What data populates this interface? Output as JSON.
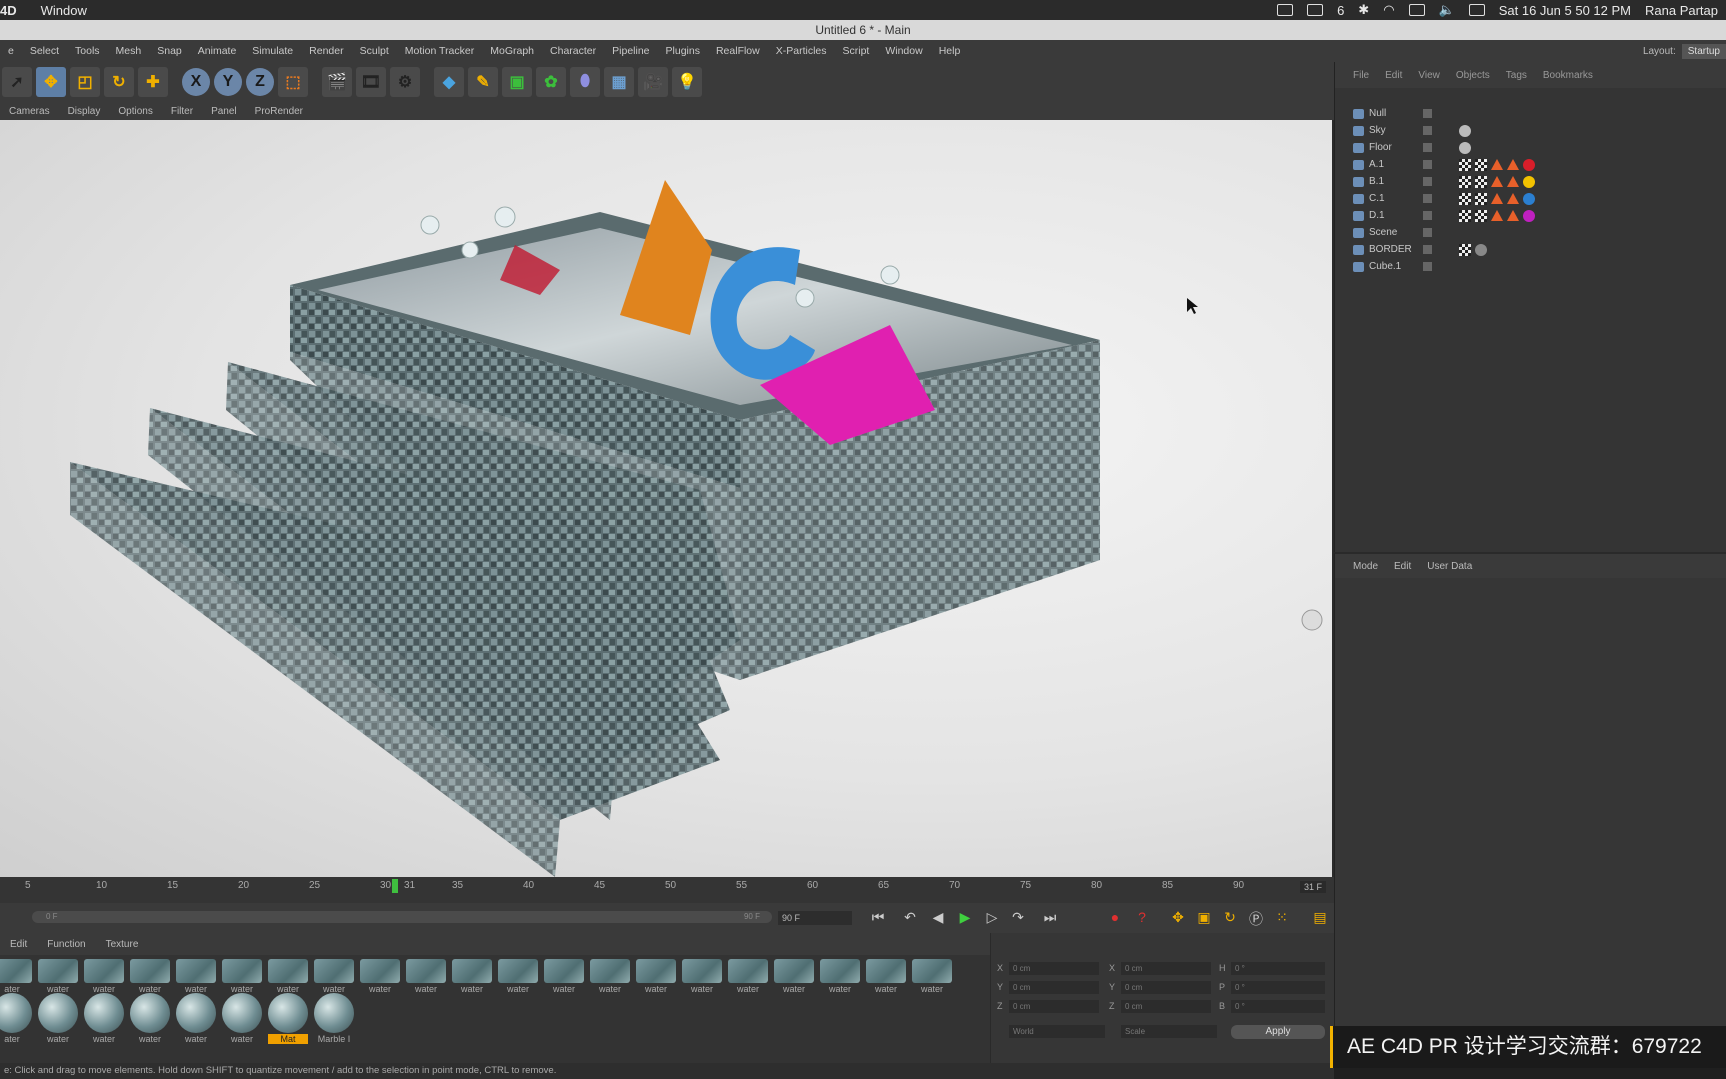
{
  "macbar": {
    "app": "4D",
    "menus": [
      "Window"
    ],
    "badge": "6",
    "datetime": "Sat 16 Jun  5 50 12 PM",
    "user": "Rana Partap"
  },
  "window": {
    "title": "Untitled 6 * - Main"
  },
  "menu": {
    "items": [
      "e",
      "Select",
      "Tools",
      "Mesh",
      "Snap",
      "Animate",
      "Simulate",
      "Render",
      "Sculpt",
      "Motion Tracker",
      "MoGraph",
      "Character",
      "Pipeline",
      "Plugins",
      "RealFlow",
      "X-Particles",
      "Script",
      "Window",
      "Help"
    ],
    "layout_label": "Layout:",
    "layout_value": "Startup"
  },
  "toolbar": {
    "x": "X",
    "y": "Y",
    "z": "Z"
  },
  "viewport": {
    "menu": [
      "Cameras",
      "Display",
      "Options",
      "Filter",
      "Panel",
      "ProRender"
    ]
  },
  "timeline": {
    "ticks": [
      "5",
      "10",
      "15",
      "20",
      "25",
      "30",
      "31",
      "35",
      "40",
      "45",
      "50",
      "55",
      "60",
      "65",
      "70",
      "75",
      "80",
      "85",
      "90"
    ],
    "current": 31,
    "current_label": "31 F",
    "range_start": "0 F",
    "range_end": "90 F",
    "end_frame": "90 F"
  },
  "materials": {
    "menu": [
      "Edit",
      "Function",
      "Texture"
    ],
    "row1": [
      "ater",
      "water",
      "water",
      "water",
      "water",
      "water",
      "water",
      "water",
      "water",
      "water",
      "water",
      "water",
      "water",
      "water",
      "water",
      "water",
      "water",
      "water",
      "water",
      "water",
      "water"
    ],
    "row2": [
      "ater",
      "water",
      "water",
      "water",
      "water",
      "water",
      "Mat",
      "Marble I"
    ]
  },
  "coords": {
    "x": "X",
    "y": "Y",
    "z": "Z",
    "h": "H",
    "p": "P",
    "b": "B",
    "pos": [
      "0 cm",
      "0 cm",
      "0 cm"
    ],
    "size": [
      "0 cm",
      "0 cm",
      "0 cm"
    ],
    "rot": [
      "0 °",
      "0 °",
      "0 °"
    ],
    "world": "World",
    "scale": "Scale",
    "apply": "Apply"
  },
  "status": "e: Click and drag to move elements. Hold down SHIFT to quantize movement / add to the selection in point mode, CTRL to remove.",
  "object_manager": {
    "menu": [
      "File",
      "Edit",
      "View",
      "Objects",
      "Tags",
      "Bookmarks"
    ],
    "objects": [
      "Null",
      "Sky",
      "Floor",
      "A.1",
      "B.1",
      "C.1",
      "D.1",
      "Scene",
      "BORDER",
      "Cube.1"
    ],
    "ball_colors": [
      "#d81e2a",
      "#f2c200",
      "#2b7fd0",
      "#c020c0"
    ]
  },
  "attributes": {
    "menu": [
      "Mode",
      "Edit",
      "User Data"
    ]
  },
  "watermark": "AE C4D PR 设计学习交流群：679722"
}
